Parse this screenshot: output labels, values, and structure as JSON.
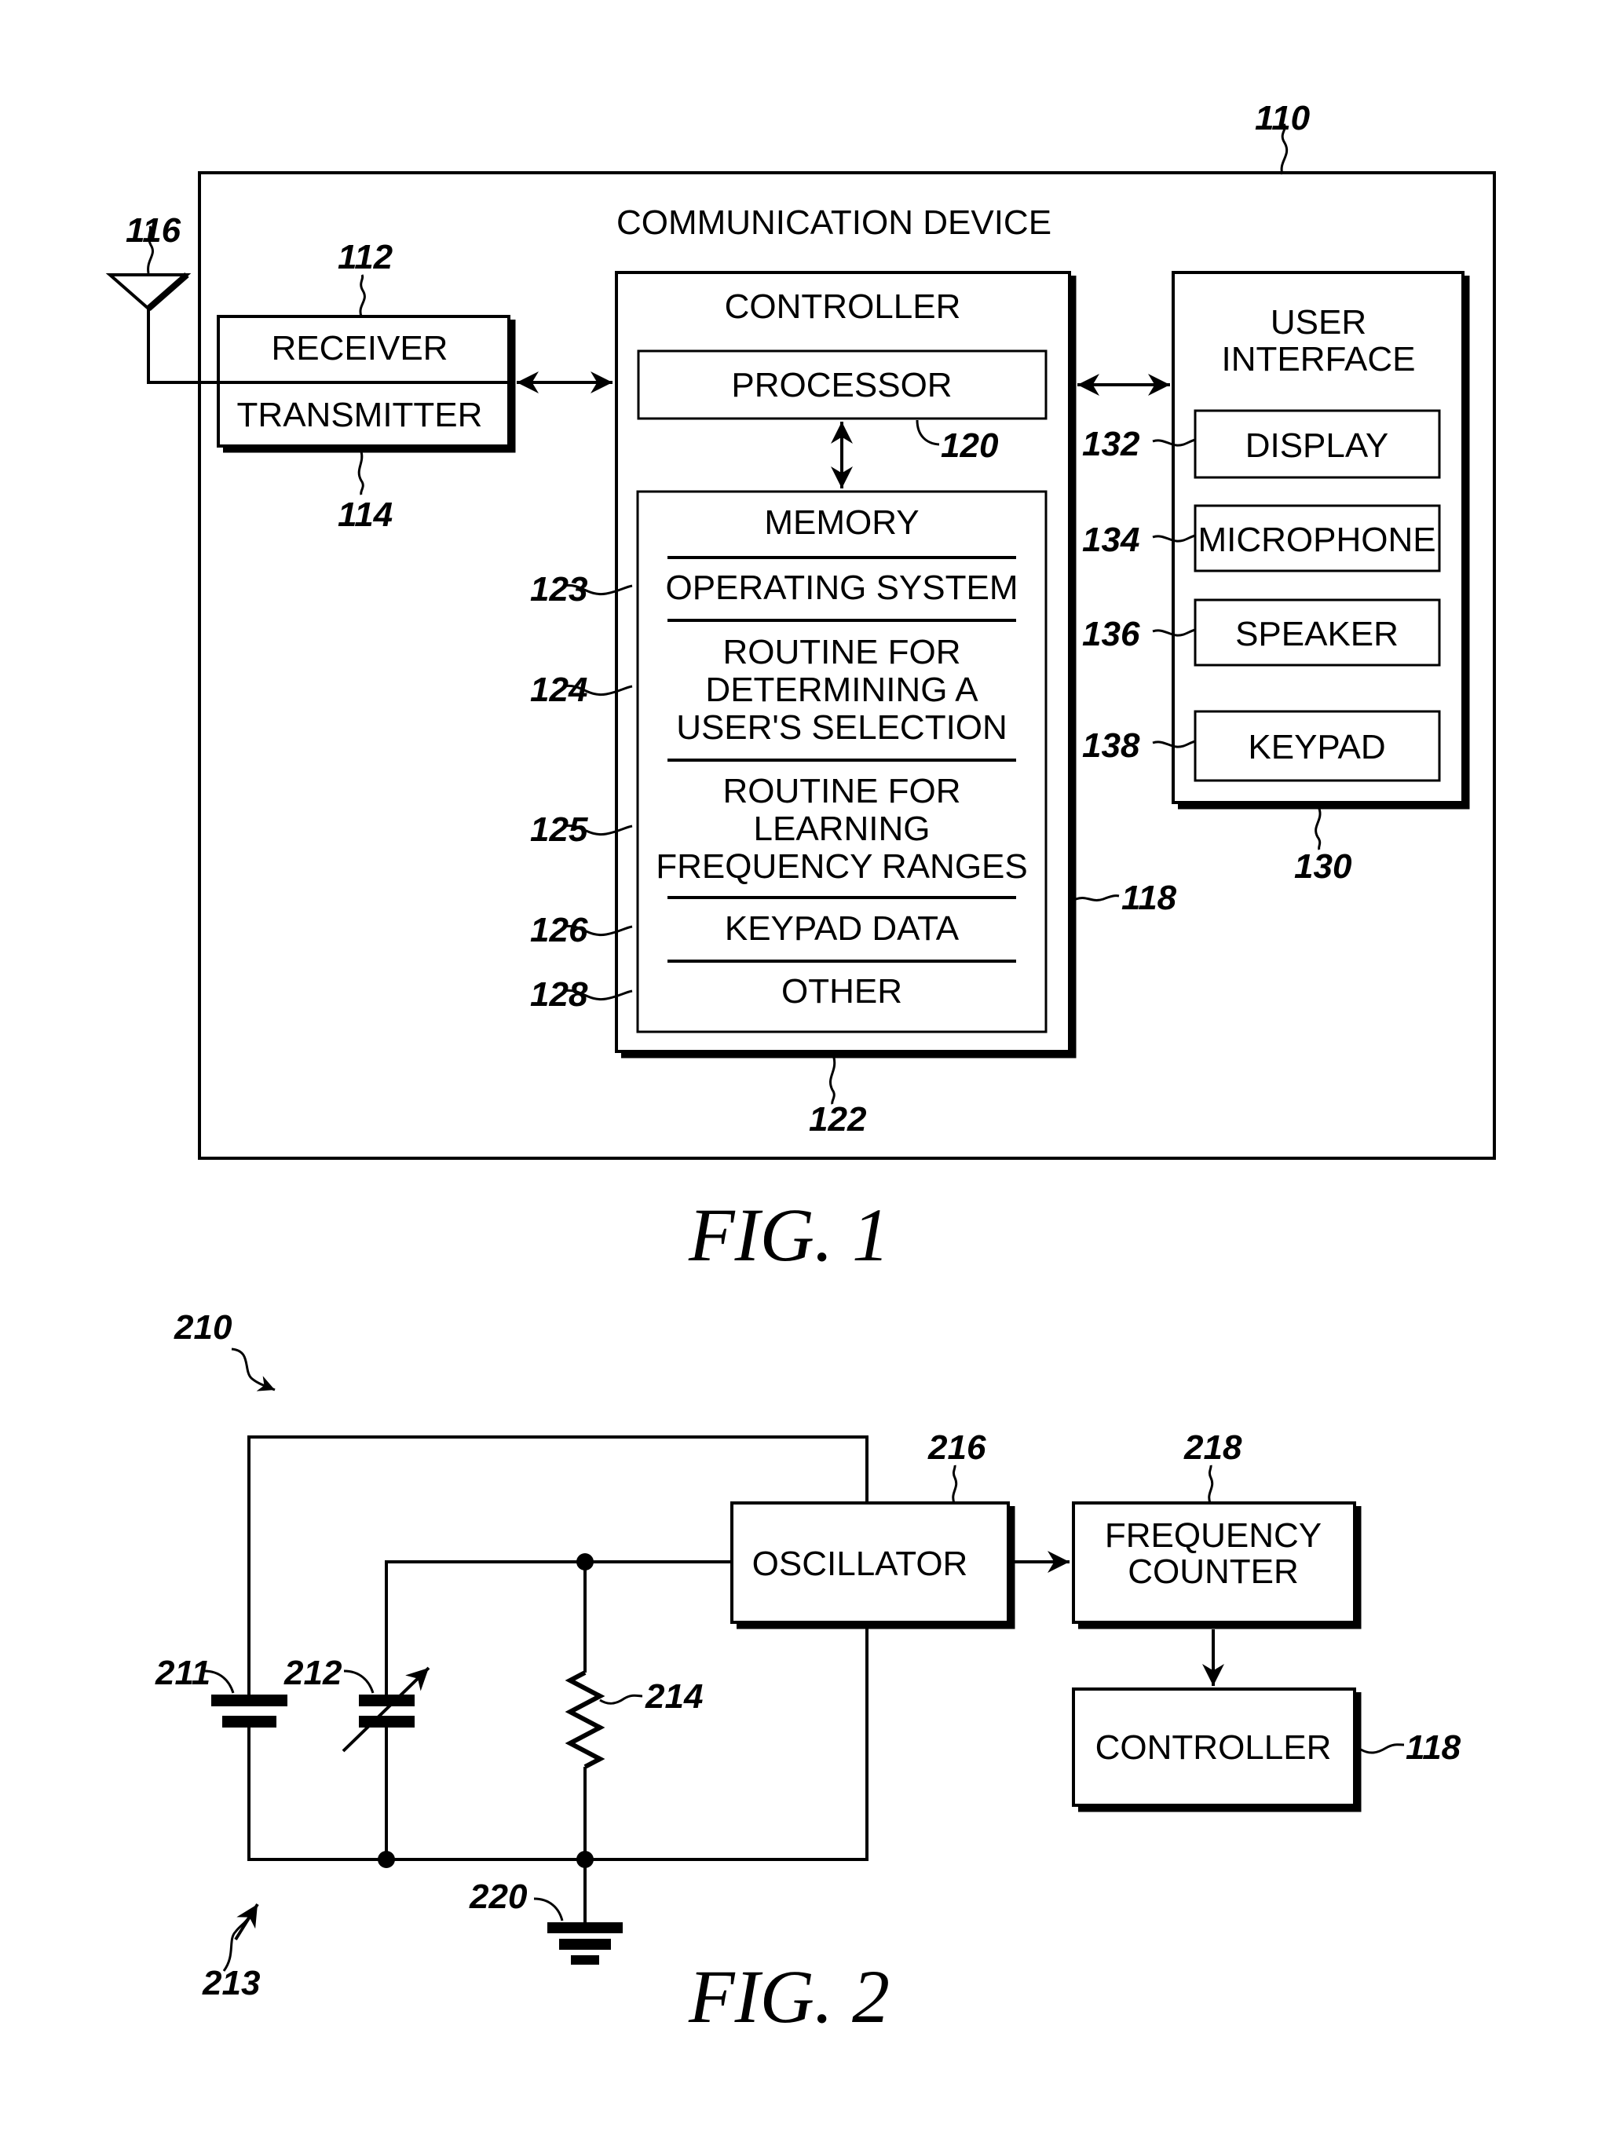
{
  "fig1": {
    "caption": "FIG. 1",
    "device": {
      "title": "COMMUNICATION DEVICE",
      "ref": "110"
    },
    "antenna": {
      "ref": "116"
    },
    "receiver": {
      "label": "RECEIVER",
      "ref": "112"
    },
    "transmitter": {
      "label": "TRANSMITTER",
      "ref": "114"
    },
    "controller": {
      "label": "CONTROLLER",
      "ref": "122",
      "processor": {
        "label": "PROCESSOR",
        "ref": "120"
      },
      "memory": {
        "label": "MEMORY",
        "ref": "118",
        "items": [
          {
            "ref": "123",
            "lines": [
              "OPERATING SYSTEM"
            ]
          },
          {
            "ref": "124",
            "lines": [
              "ROUTINE FOR",
              "DETERMINING A",
              "USER'S SELECTION"
            ]
          },
          {
            "ref": "125",
            "lines": [
              "ROUTINE FOR",
              "LEARNING",
              "FREQUENCY RANGES"
            ]
          },
          {
            "ref": "126",
            "lines": [
              "KEYPAD DATA"
            ]
          },
          {
            "ref": "128",
            "lines": [
              "OTHER"
            ]
          }
        ]
      }
    },
    "user_interface": {
      "label_line1": "USER",
      "label_line2": "INTERFACE",
      "ref": "130",
      "items": [
        {
          "label": "DISPLAY",
          "ref": "132"
        },
        {
          "label": "MICROPHONE",
          "ref": "134"
        },
        {
          "label": "SPEAKER",
          "ref": "136"
        },
        {
          "label": "KEYPAD",
          "ref": "138"
        }
      ]
    }
  },
  "fig2": {
    "caption": "FIG. 2",
    "circuit_ref": "210",
    "tank_ref": "213",
    "capacitor_fixed_ref": "211",
    "capacitor_variable_ref": "212",
    "resistor_ref": "214",
    "ground_ref": "220",
    "oscillator": {
      "label": "OSCILLATOR",
      "ref": "216"
    },
    "frequency_counter": {
      "label_line1": "FREQUENCY",
      "label_line2": "COUNTER",
      "ref": "218"
    },
    "controller": {
      "label": "CONTROLLER",
      "ref": "118"
    }
  }
}
